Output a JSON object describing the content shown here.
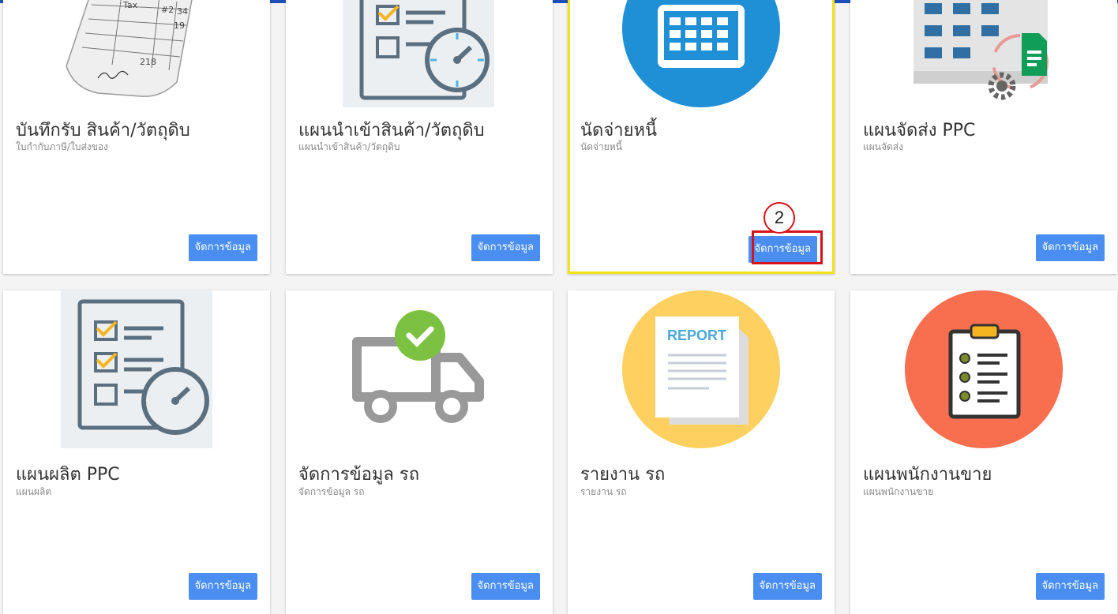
{
  "cards": [
    {
      "title": "บันทึกรับ สินค้า/วัตถุดิบ",
      "subtitle": "ใบกำกับภาษี/ใบส่งของ",
      "button": "จัดการข้อมูล",
      "icon": "receipt-icon"
    },
    {
      "title": "แผนนำเข้าสินค้า/วัตถุดิบ",
      "subtitle": "แผนนำเข้าสินค้า/วัตถุดิบ",
      "button": "จัดการข้อมูล",
      "icon": "checklist-timer-icon"
    },
    {
      "title": "นัดจ่ายหนี้",
      "subtitle": "นัดจ่ายหนี้",
      "button": "จัดการข้อมูล",
      "icon": "calendar-icon"
    },
    {
      "title": "แผนจัดส่ง PPC",
      "subtitle": "แผนจัดส่ง",
      "button": "จัดการข้อมูล",
      "icon": "building-sheet-gear-icon"
    },
    {
      "title": "แผนผลิต PPC",
      "subtitle": "แผนผลิต",
      "button": "จัดการข้อมูล",
      "icon": "checklist-timer-icon"
    },
    {
      "title": "จัดการข้อมูล รถ",
      "subtitle": "จัดการข้อมูล รถ",
      "button": "จัดการข้อมูล",
      "icon": "truck-check-icon"
    },
    {
      "title": "รายงาน รถ",
      "subtitle": "รายงาน รถ",
      "button": "จัดการข้อมูล",
      "icon": "report-icon"
    },
    {
      "title": "แผนพนักงานขาย",
      "subtitle": "แผนพนักงานขาย",
      "button": "จัดการข้อมูล",
      "icon": "clipboard-icon"
    }
  ],
  "annotation": {
    "step_number": "2"
  },
  "report_icon_text": "REPORT",
  "receipt_icon_text": {
    "tax": "Tax",
    "num1": "#2",
    "num2": "34",
    "num3": "19",
    "num4": "218"
  },
  "colors": {
    "button": "#4a8ef2",
    "highlight": "#f2e21a",
    "annotation": "#d8121b",
    "calendar_bg": "#1f8fd6",
    "report_bg": "#fdd060",
    "clipboard_bg": "#f86f4f",
    "truck_check": "#7dc142"
  }
}
